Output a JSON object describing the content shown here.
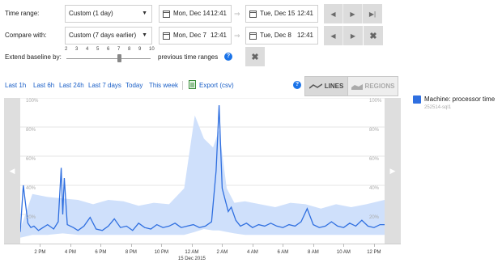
{
  "controls": {
    "time_range_label": "Time range:",
    "time_range_value": "Custom (1 day)",
    "time_range_start_date": "Mon, Dec 14",
    "time_range_start_time": "12:41",
    "time_range_end_date": "Tue, Dec 15",
    "time_range_end_time": "12:41",
    "compare_label": "Compare with:",
    "compare_value": "Custom (7 days earlier)",
    "compare_start_date": "Mon, Dec 7",
    "compare_start_time": "12:41",
    "compare_end_date": "Tue, Dec 8",
    "compare_end_time": "12:41",
    "baseline_label": "Extend baseline by:",
    "baseline_ticks": [
      "2",
      "3",
      "4",
      "5",
      "6",
      "7",
      "8",
      "9",
      "10"
    ],
    "baseline_value": 7,
    "baseline_suffix": "previous time ranges",
    "help_glyph": "?"
  },
  "quick_links": {
    "last_1h": "Last 1h",
    "last_6h": "Last 6h",
    "last_24h": "Last 24h",
    "last_7days": "Last 7 days",
    "today": "Today",
    "this_week": "This week",
    "export": "Export (csv)"
  },
  "view_toggle": {
    "lines": "LINES",
    "regions": "REGIONS",
    "selected": "lines"
  },
  "legend": {
    "series_name": "Machine: processor time",
    "series_source": "252514-sql1",
    "series_color": "#2f6fe0"
  },
  "colors": {
    "band": "#cfe0fb",
    "line": "#2f6fe0",
    "nav_button": "#dcdcdc"
  },
  "chart_data": {
    "type": "line",
    "ylim": [
      0,
      100
    ],
    "y_ticks": [
      "100%",
      "80%",
      "60%",
      "40%",
      "20%"
    ],
    "x_ticks": [
      "2 PM",
      "4 PM",
      "6 PM",
      "8 PM",
      "10 PM",
      "12 AM",
      "2 AM",
      "4 AM",
      "6 AM",
      "8 AM",
      "10 AM",
      "12 PM"
    ],
    "x_sublabel": "15 Dec 2015",
    "x_sublabel_under": "12 AM",
    "series": [
      {
        "name": "Machine: processor time",
        "x": [
          12.7,
          12.9,
          13.2,
          13.4,
          13.6,
          13.9,
          14.2,
          14.5,
          14.9,
          15.2,
          15.4,
          15.5,
          15.6,
          15.8,
          16.2,
          16.5,
          16.9,
          17.3,
          17.7,
          18.1,
          18.5,
          18.9,
          19.3,
          19.7,
          20.1,
          20.5,
          20.9,
          21.3,
          21.7,
          22.1,
          22.5,
          22.9,
          23.3,
          23.7,
          24.1,
          24.5,
          24.9,
          25.3,
          25.6,
          25.8,
          26.0,
          26.2,
          26.4,
          26.6,
          26.9,
          27.2,
          27.6,
          28.0,
          28.4,
          28.8,
          29.2,
          29.6,
          30.0,
          30.4,
          30.8,
          31.2,
          31.6,
          32.0,
          32.4,
          32.8,
          33.2,
          33.6,
          34.0,
          34.4,
          34.8,
          35.2,
          35.6,
          36.0,
          36.4,
          36.7
        ],
        "values": [
          8,
          40,
          14,
          11,
          12,
          9,
          11,
          13,
          10,
          15,
          52,
          20,
          45,
          13,
          11,
          9,
          12,
          18,
          10,
          9,
          12,
          17,
          11,
          12,
          9,
          14,
          11,
          10,
          13,
          11,
          12,
          14,
          11,
          12,
          13,
          11,
          12,
          15,
          50,
          95,
          38,
          30,
          22,
          25,
          16,
          12,
          14,
          11,
          13,
          12,
          14,
          12,
          11,
          13,
          12,
          15,
          24,
          13,
          11,
          12,
          15,
          12,
          11,
          14,
          12,
          16,
          12,
          11,
          13,
          13
        ]
      },
      {
        "name": "Baseline range",
        "x": [
          12.7,
          13.5,
          14.5,
          15.5,
          16.5,
          17.5,
          18.5,
          19.5,
          20.5,
          21.5,
          22.5,
          23.5,
          24.2,
          24.8,
          25.4,
          25.8,
          26.3,
          26.8,
          27.5,
          28.5,
          29.5,
          30.5,
          31.5,
          32.5,
          33.5,
          34.5,
          35.5,
          36.7
        ],
        "upper": [
          10,
          34,
          32,
          31,
          30,
          27,
          30,
          29,
          26,
          28,
          27,
          38,
          88,
          72,
          66,
          78,
          38,
          28,
          29,
          27,
          25,
          28,
          27,
          24,
          27,
          25,
          27,
          30
        ],
        "lower": [
          4,
          6,
          6,
          7,
          6,
          6,
          6,
          6,
          6,
          6,
          6,
          6,
          8,
          10,
          9,
          9,
          8,
          7,
          6,
          6,
          6,
          6,
          6,
          6,
          6,
          6,
          6,
          6
        ]
      }
    ]
  }
}
